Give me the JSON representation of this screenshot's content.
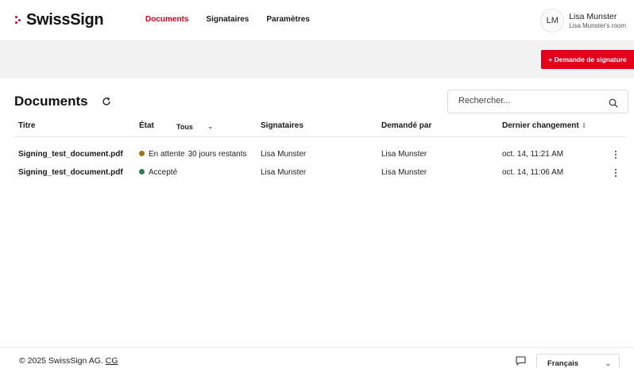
{
  "brand": {
    "name": "SwissSign",
    "color": "#e2001a"
  },
  "nav": [
    {
      "label": "Documents",
      "active": true
    },
    {
      "label": "Signataires",
      "active": false
    },
    {
      "label": "Paramètres",
      "active": false
    }
  ],
  "user": {
    "initials": "LM",
    "name": "Lisa Munster",
    "room": "Lisa Munster's room"
  },
  "actions": {
    "new_request": "+ Demande de signature"
  },
  "page": {
    "title": "Documents",
    "refresh_icon": "refresh-icon"
  },
  "search": {
    "placeholder": "Rechercher...",
    "value": "",
    "icon": "search-icon"
  },
  "table": {
    "columns": {
      "title": "Titre",
      "state": "État",
      "state_filter": "Tous",
      "signers": "Signataires",
      "requested_by": "Demandé par",
      "last_change": "Dernier changement"
    },
    "rows": [
      {
        "file": "Signing_test_document.pdf",
        "status": "En attente",
        "status_color": "#a0701a",
        "remaining": "30 jours restants",
        "signer": "Lisa Munster",
        "requester": "Lisa Munster",
        "changed": "oct. 14, 11:21 AM"
      },
      {
        "file": "Signing_test_document.pdf",
        "status": "Accepté",
        "status_color": "#2e7d4f",
        "remaining": "",
        "signer": "Lisa Munster",
        "requester": "Lisa Munster",
        "changed": "oct. 14, 11:06 AM"
      }
    ]
  },
  "footer": {
    "copyright": "© 2025 SwissSign AG.",
    "link": "CG",
    "language": "Français",
    "feedback_icon": "chat-icon"
  }
}
